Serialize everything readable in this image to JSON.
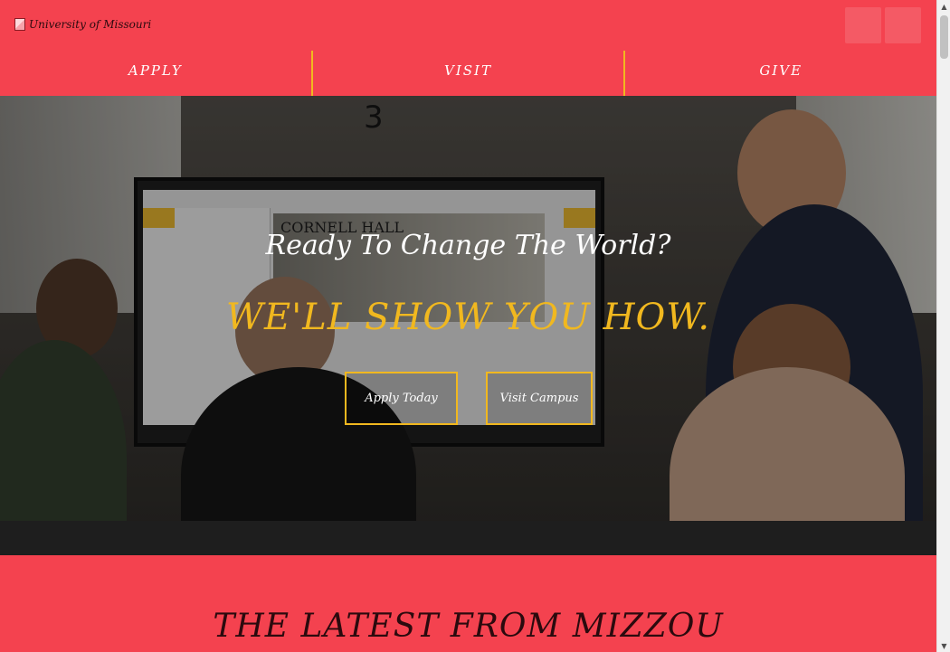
{
  "header": {
    "logo_alt": "University of Missouri"
  },
  "nav": {
    "items": [
      {
        "label": "APPLY"
      },
      {
        "label": "VISIT"
      },
      {
        "label": "GIVE"
      }
    ]
  },
  "hero": {
    "room_number": "3",
    "tv_banner": "CORNELL HALL",
    "title": "Ready To Change The World?",
    "subtitle": "WE'LL SHOW YOU HOW.",
    "apply_button": "Apply Today",
    "visit_button": "Visit Campus"
  },
  "latest": {
    "title": "THE LATEST FROM MIZZOU"
  },
  "colors": {
    "brand_red": "#f4424f",
    "accent_gold": "#f1b81f"
  }
}
